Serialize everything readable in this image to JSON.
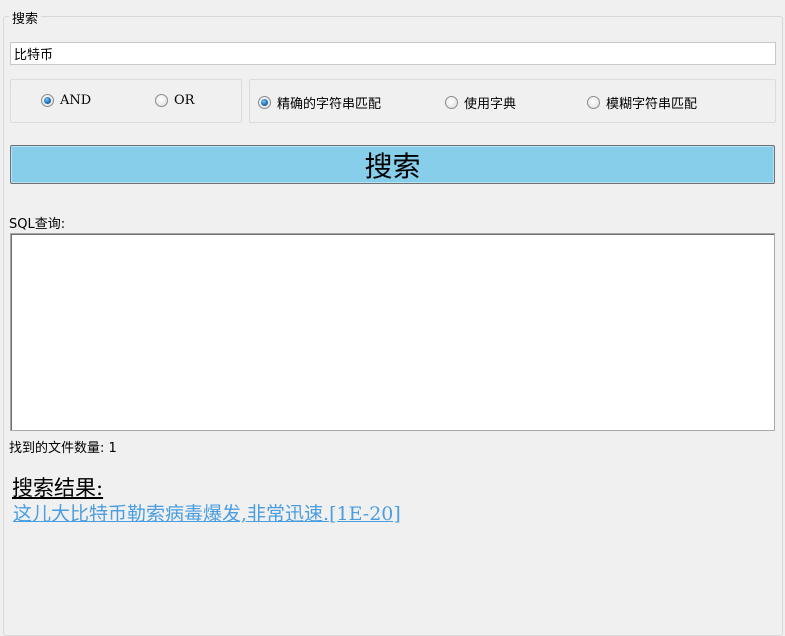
{
  "search_group": {
    "title": "搜索"
  },
  "search_input": {
    "value": "比特币"
  },
  "logic_options": [
    {
      "label": "AND",
      "checked": true
    },
    {
      "label": "OR",
      "checked": false
    }
  ],
  "match_options": [
    {
      "label": "精确的字符串匹配",
      "checked": true
    },
    {
      "label": "使用字典",
      "checked": false
    },
    {
      "label": "模糊字符串匹配",
      "checked": false
    }
  ],
  "search_button": {
    "label": "搜索",
    "color": "#87ceeb"
  },
  "sql": {
    "label": "SQL查询:",
    "value": ""
  },
  "result_count": {
    "label": "找到的文件数量: 1"
  },
  "results": {
    "heading": "搜索结果: ",
    "items": [
      {
        "text": " 这儿大比特币勒索病毒爆发,非常迅速.[1E-20]",
        "color": "#4a9ee0"
      }
    ]
  }
}
